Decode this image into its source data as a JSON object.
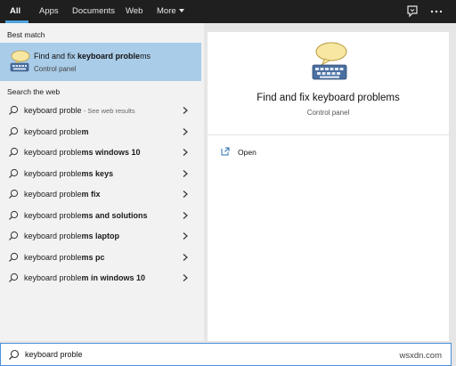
{
  "tabs": [
    {
      "label": "All",
      "active": true
    },
    {
      "label": "Apps"
    },
    {
      "label": "Documents"
    },
    {
      "label": "Web"
    },
    {
      "label": "More"
    }
  ],
  "top_icons": [
    "feedback-icon",
    "more-options-icon"
  ],
  "left": {
    "best_match_label": "Best match",
    "best_match": {
      "title_prefix": "Find and fix ",
      "title_bold": "keyboard proble",
      "title_suffix": "ms",
      "subtitle": "Control panel",
      "icon": "keyboard-troubleshooter-icon"
    },
    "search_web_label": "Search the web",
    "suggestions": [
      {
        "prefix": "keyboard proble",
        "bold": "",
        "hint": " - See web results"
      },
      {
        "prefix": "keyboard proble",
        "bold": "m",
        "hint": ""
      },
      {
        "prefix": "keyboard proble",
        "bold": "ms windows 10",
        "hint": ""
      },
      {
        "prefix": "keyboard proble",
        "bold": "ms keys",
        "hint": ""
      },
      {
        "prefix": "keyboard proble",
        "bold": "m fix",
        "hint": ""
      },
      {
        "prefix": "keyboard proble",
        "bold": "ms and solutions",
        "hint": ""
      },
      {
        "prefix": "keyboard proble",
        "bold": "ms laptop",
        "hint": ""
      },
      {
        "prefix": "keyboard proble",
        "bold": "ms pc",
        "hint": ""
      },
      {
        "prefix": "keyboard proble",
        "bold": "m in windows 10",
        "hint": ""
      }
    ]
  },
  "right": {
    "title": "Find and fix keyboard problems",
    "subtitle": "Control panel",
    "action_open": "Open",
    "icon": "keyboard-troubleshooter-icon"
  },
  "search": {
    "value": "keyboard proble"
  },
  "watermark": "wsxdn.com",
  "colors": {
    "topbar": "#1f1f1f",
    "accent": "#4fa3e0",
    "best_match_bg": "#a9cce8",
    "panel_bg": "#f2f2f2"
  }
}
